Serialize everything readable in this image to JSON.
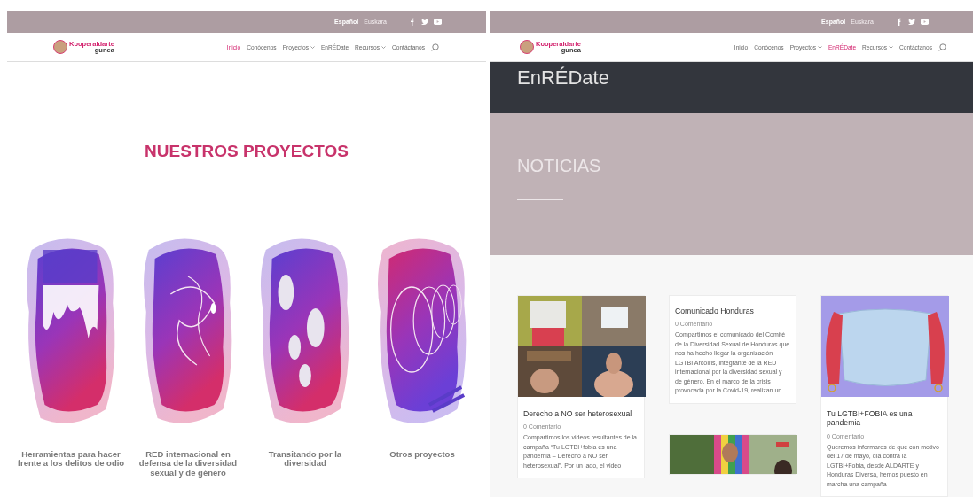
{
  "left_page": {
    "top_bar": {
      "languages": [
        {
          "label": "Español",
          "selected": true
        },
        {
          "label": "Euskara",
          "selected": false
        }
      ]
    },
    "nav": {
      "logo": "Kooperaldarte",
      "logo_sub": "gunea",
      "items": [
        {
          "label": "Inicio",
          "selected": true,
          "dropdown": false
        },
        {
          "label": "Conócenos",
          "selected": false,
          "dropdown": false
        },
        {
          "label": "Proyectos",
          "selected": false,
          "dropdown": true
        },
        {
          "label": "EnRÉDate",
          "selected": false,
          "dropdown": false
        },
        {
          "label": "Recursos",
          "selected": false,
          "dropdown": true
        },
        {
          "label": "Contáctanos",
          "selected": false,
          "dropdown": false
        }
      ]
    },
    "heading": "NUESTROS PROYECTOS",
    "projects": [
      {
        "title": "Herramientas para hacer frente a los delitos de odio"
      },
      {
        "title": "RED internacional en defensa de la diversidad sexual y de género"
      },
      {
        "title": "Transitando por la diversidad"
      },
      {
        "title": "Otros proyectos"
      }
    ]
  },
  "right_page": {
    "top_bar": {
      "languages": [
        {
          "label": "Español",
          "selected": true
        },
        {
          "label": "Euskara",
          "selected": false
        }
      ]
    },
    "nav": {
      "logo": "Kooperaldarte",
      "logo_sub": "gunea",
      "items": [
        {
          "label": "Inicio",
          "selected": false,
          "dropdown": false
        },
        {
          "label": "Conócenos",
          "selected": false,
          "dropdown": false
        },
        {
          "label": "Proyectos",
          "selected": false,
          "dropdown": true
        },
        {
          "label": "EnRÉDate",
          "selected": true,
          "dropdown": false
        },
        {
          "label": "Recursos",
          "selected": false,
          "dropdown": true
        },
        {
          "label": "Contáctanos",
          "selected": false,
          "dropdown": false
        }
      ]
    },
    "page_title": "EnRÉDate",
    "section_title": "NOTICIAS",
    "columns": [
      [
        {
          "title": "Derecho a NO ser heterosexual",
          "comments": "0 Comentario",
          "excerpt": "Compartimos los videos resultantes de la campaña “Tu LGTBI+fobia es una pandemia – Derecho a NO ser heterosexual”.  Por un lado, el video"
        }
      ],
      [
        {
          "kind": "text",
          "title": "Comunicado Honduras",
          "comments": "0 Comentario",
          "excerpt": "Compartimos el comunicado del Comité de la Diversidad Sexual de Honduras que nos ha hecho llegar la organización LGTBI Arcoíris, integrante de la RED internacional por la diversidad sexual y de género. En el marco de la crisis provocada por la Covid-19, realizan un…"
        },
        {
          "kind": "image-only"
        }
      ],
      [
        {
          "title": "Tu LGTBI+FOBIA es una pandemia",
          "comments": "0 Comentario",
          "excerpt": "Queremos informaros de que con motivo del 17 de mayo, día contra la LGTBI+Fobia, desde ALDARTE y Honduras Diversa, hemos puesto en marcha una campaña"
        }
      ]
    ]
  }
}
